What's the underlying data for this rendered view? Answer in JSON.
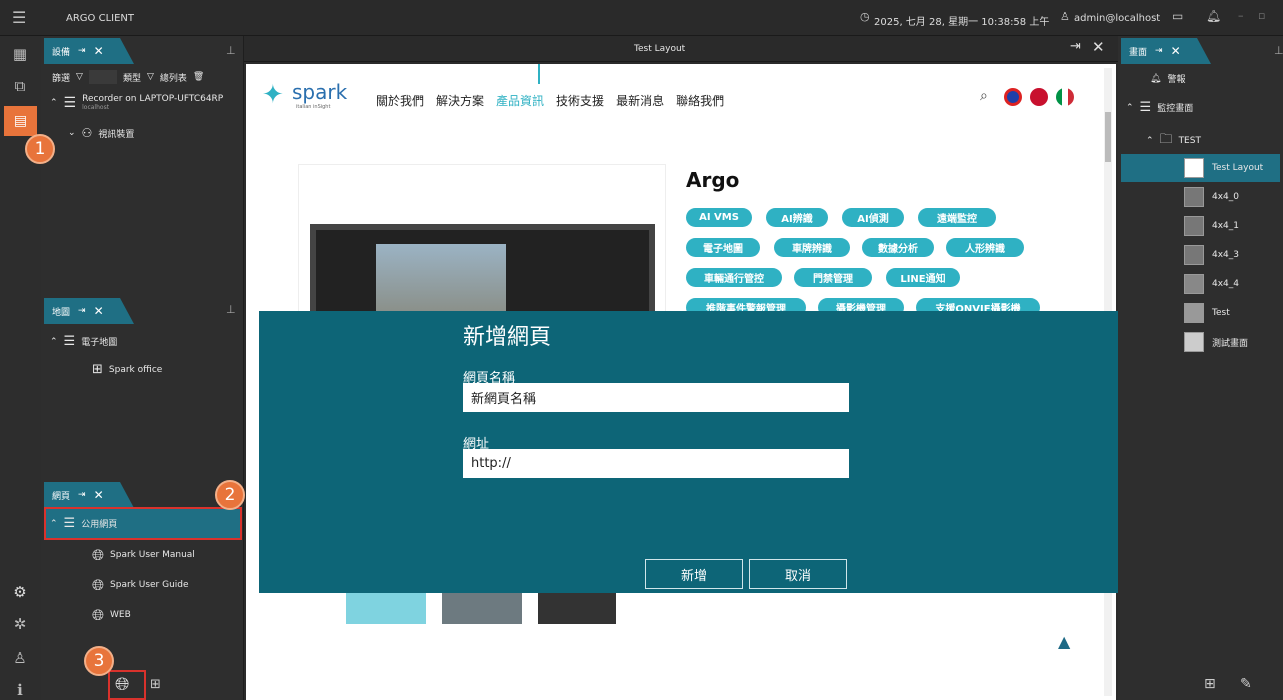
{
  "app": {
    "title": "ARGO CLIENT",
    "datetime": "2025, 七月 28, 星期一 10:38:58 上午",
    "user": "admin@localhost"
  },
  "device_panel": {
    "tab": "設備",
    "filter_label": "篩選",
    "type_label": "類型",
    "list_label": "總列表",
    "recorder": "Recorder on LAPTOP-UFTC64RP",
    "recorder_sub": "localhost",
    "video": "視訊裝置"
  },
  "map_panel": {
    "tab": "地圖",
    "group": "電子地圖",
    "item": "Spark office"
  },
  "web_panel": {
    "tab": "網頁",
    "group": "公用網頁",
    "items": [
      "Spark User Manual",
      "Spark User Guide",
      "WEB"
    ]
  },
  "badges": [
    "1",
    "2",
    "3"
  ],
  "center_tab": "Test Layout",
  "site": {
    "logo": "spark",
    "logo_sub": "italian inSight",
    "nav": [
      "關於我們",
      "解決方案",
      "產品資訊",
      "技術支援",
      "最新消息",
      "聯絡我們"
    ],
    "active_nav": "產品資訊",
    "product": "Argo",
    "chips": [
      "AI VMS",
      "AI辨識",
      "AI偵測",
      "遠端監控",
      "電子地圖",
      "車牌辨識",
      "數據分析",
      "人形辨識",
      "車輛通行管控",
      "門禁管理",
      "LINE通知",
      "推階事件警報管理",
      "攝影機管理",
      "支援ONVIF攝影機"
    ]
  },
  "dialog": {
    "title": "新增網頁",
    "name_label": "網頁名稱",
    "name_value": "新網頁名稱",
    "url_label": "網址",
    "url_value": "http://",
    "add": "新增",
    "cancel": "取消"
  },
  "right_panel": {
    "tab": "畫面",
    "alarm": "警報",
    "monitor": "監控畫面",
    "folder": "TEST",
    "layouts": [
      "Test Layout",
      "4x4_0",
      "4x4_1",
      "4x4_3",
      "4x4_4",
      "Test",
      "測試畫面"
    ]
  },
  "colors": {
    "accent": "#1f6f84",
    "dialog": "#0d6577",
    "chip": "#2fb1c3",
    "badge": "#e8743b",
    "highlight": "#d9322c"
  }
}
